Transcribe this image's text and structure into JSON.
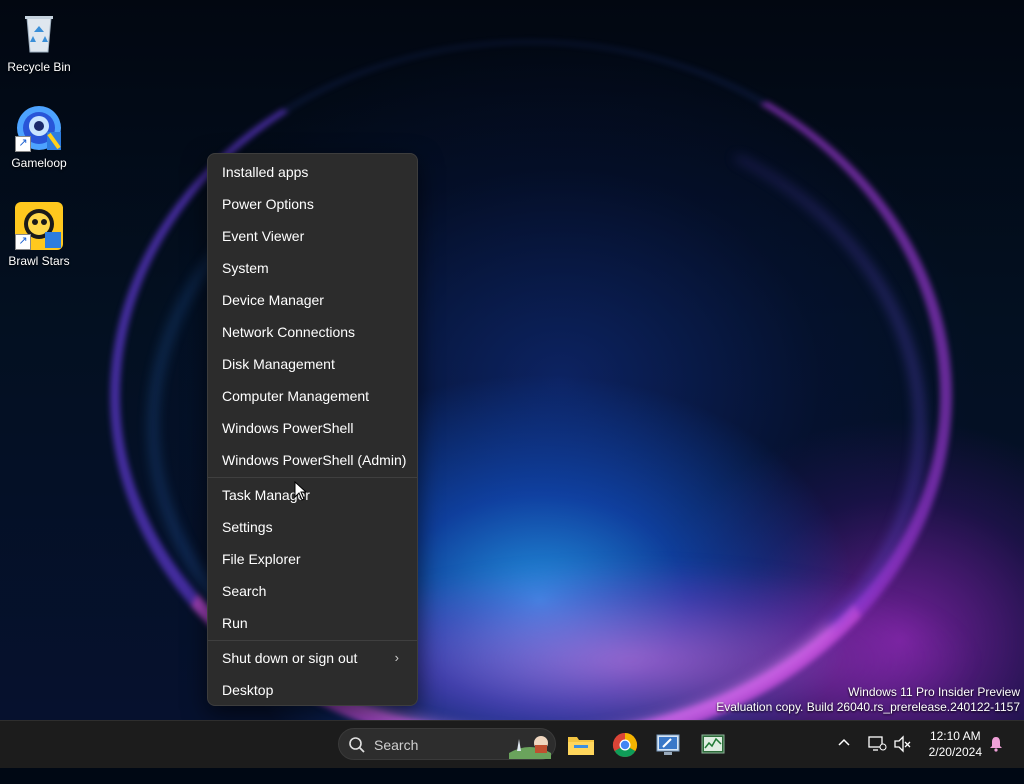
{
  "desktop": {
    "icons": [
      {
        "label": "Recycle Bin",
        "icon": "recycle-bin-icon"
      },
      {
        "label": "Gameloop",
        "icon": "gameloop-icon"
      },
      {
        "label": "Brawl Stars",
        "icon": "brawl-stars-icon"
      }
    ]
  },
  "context_menu": {
    "groups": [
      [
        "Installed apps",
        "Power Options",
        "Event Viewer",
        "System",
        "Device Manager",
        "Network Connections",
        "Disk Management",
        "Computer Management",
        "Windows PowerShell",
        "Windows PowerShell (Admin)"
      ],
      [
        "Task Manager",
        "Settings",
        "File Explorer",
        "Search",
        "Run"
      ],
      [
        "Shut down or sign out",
        "Desktop"
      ]
    ],
    "submenu_indicator": "›"
  },
  "watermark": {
    "line1": "Windows 11 Pro Insider Preview",
    "line2": "Evaluation copy. Build 26040.rs_prerelease.240122-1157"
  },
  "taskbar": {
    "search_label": "Search",
    "pinned": [
      {
        "name": "file-explorer-icon"
      },
      {
        "name": "chrome-icon"
      },
      {
        "name": "remote-desktop-icon"
      },
      {
        "name": "task-manager-icon"
      }
    ],
    "clock": {
      "time": "12:10 AM",
      "date": "2/20/2024"
    }
  },
  "colors": {
    "menu_bg": "#2c2c2c",
    "taskbar_bg": "#1c1c1c",
    "text": "#ffffff"
  }
}
